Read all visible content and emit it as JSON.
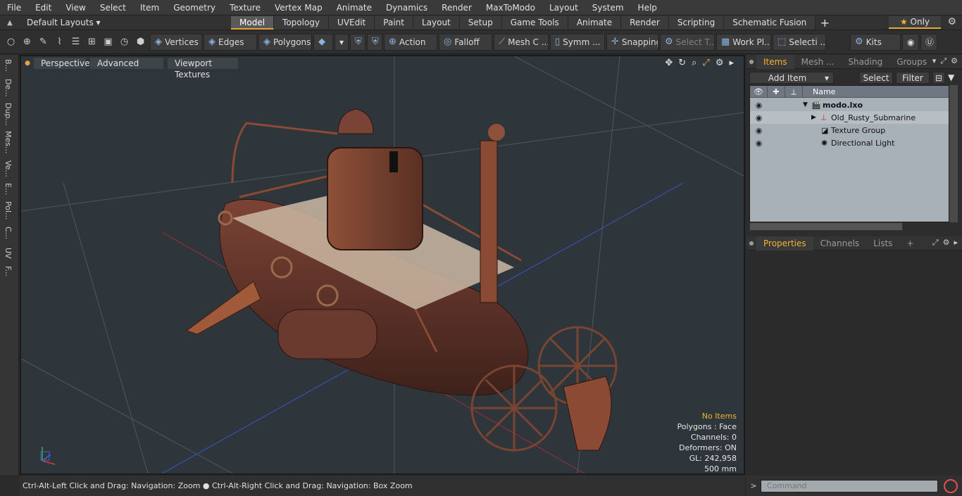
{
  "menu": [
    "File",
    "Edit",
    "View",
    "Select",
    "Item",
    "Geometry",
    "Texture",
    "Vertex Map",
    "Animate",
    "Dynamics",
    "Render",
    "MaxToModo",
    "Layout",
    "System",
    "Help"
  ],
  "layoutbar": {
    "layouts_label": "Default Layouts",
    "tabs": [
      "Model",
      "Topology",
      "UVEdit",
      "Paint",
      "Layout",
      "Setup",
      "Game Tools",
      "Animate",
      "Render",
      "Scripting",
      "Schematic Fusion"
    ],
    "active_tab": "Model",
    "only_label": "Only"
  },
  "toolbar": {
    "vertices": "Vertices",
    "edges": "Edges",
    "polygons": "Polygons",
    "action": "Action",
    "falloff": "Falloff",
    "mesh": "Mesh C ...",
    "symmetry": "Symm ...",
    "snapping": "Snapping",
    "select_t": "Select T...",
    "work_plane": "Work Pl...",
    "selection": "Selecti ...",
    "kits": "Kits"
  },
  "left_strip": [
    "B...",
    "De...",
    "Dup...",
    "Mes...",
    "Ve...",
    "E...",
    "Pol...",
    "C...",
    "UV",
    "F..."
  ],
  "viewport": {
    "tabs": [
      "Perspective",
      "Advanced",
      "Viewport Textures"
    ],
    "stats": {
      "selection": "No Items",
      "polygons": "Polygons : Face",
      "channels": "Channels: 0",
      "deformers": "Deformers: ON",
      "gl": "GL: 242,958",
      "scale": "500 mm"
    },
    "colors": {
      "hull": "#6b3a2f",
      "rust": "#8a4a33",
      "deck": "#cbb9a3",
      "background": "#2e363c"
    }
  },
  "status": "Ctrl-Alt-Left Click and Drag: Navigation: Zoom ● Ctrl-Alt-Right Click and Drag: Navigation: Box Zoom",
  "items_panel": {
    "tabs": [
      "Items",
      "Mesh ...",
      "Shading",
      "Groups"
    ],
    "add_item": "Add Item",
    "select": "Select",
    "filter": "Filter",
    "column_name": "Name",
    "rows": [
      {
        "label": "modo.lxo",
        "depth": 0,
        "bold": true
      },
      {
        "label": "Old_Rusty_Submarine",
        "depth": 1,
        "bold": false
      },
      {
        "label": "Texture Group",
        "depth": 1,
        "bold": false
      },
      {
        "label": "Directional Light",
        "depth": 1,
        "bold": false
      }
    ]
  },
  "properties_panel": {
    "tabs": [
      "Properties",
      "Channels",
      "Lists"
    ]
  },
  "command": {
    "placeholder": "Command"
  }
}
